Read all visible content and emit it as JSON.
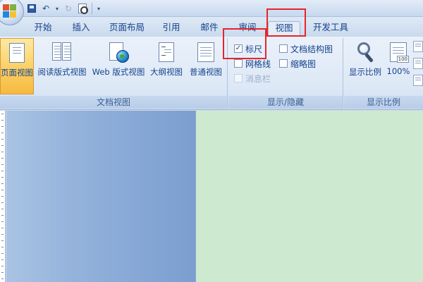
{
  "quick_access": {
    "save_icon": "save-icon",
    "undo_icon": "undo-icon",
    "redo_icon": "redo-icon",
    "print_preview_icon": "print-preview-icon",
    "customize_icon": "customize-qat-icon"
  },
  "tabs": [
    {
      "label": "开始",
      "active": false
    },
    {
      "label": "插入",
      "active": false
    },
    {
      "label": "页面布局",
      "active": false
    },
    {
      "label": "引用",
      "active": false
    },
    {
      "label": "邮件",
      "active": false
    },
    {
      "label": "审阅",
      "active": false
    },
    {
      "label": "视图",
      "active": true
    },
    {
      "label": "开发工具",
      "active": false
    }
  ],
  "ribbon": {
    "doc_views": {
      "label": "文档视图",
      "buttons": [
        {
          "label": "页面视图",
          "icon": "page-view-icon",
          "active": true
        },
        {
          "label": "阅读版式视图",
          "icon": "reading-view-icon",
          "active": false
        },
        {
          "label": "Web 版式视图",
          "icon": "web-layout-icon",
          "active": false
        },
        {
          "label": "大纲视图",
          "icon": "outline-view-icon",
          "active": false
        },
        {
          "label": "普通视图",
          "icon": "draft-view-icon",
          "active": false
        }
      ]
    },
    "show_hide": {
      "label": "显示/隐藏",
      "ruler": {
        "label": "标尺",
        "checked": true
      },
      "gridlines": {
        "label": "网格线",
        "checked": false
      },
      "message_bar": {
        "label": "消息栏",
        "checked": false,
        "disabled": true
      },
      "doc_map": {
        "label": "文档结构图",
        "checked": false
      },
      "thumbnails": {
        "label": "缩略图",
        "checked": false
      },
      "check_mark": "✓"
    },
    "zoom": {
      "label": "显示比例",
      "zoom_button": "显示比例",
      "hundred_button": "100%",
      "hundred_tag": "100"
    }
  },
  "colors": {
    "highlight": "#e8242a",
    "active_button": "#fbd46d",
    "page_background": "#cde9cf",
    "workspace": "#94b3dc"
  }
}
